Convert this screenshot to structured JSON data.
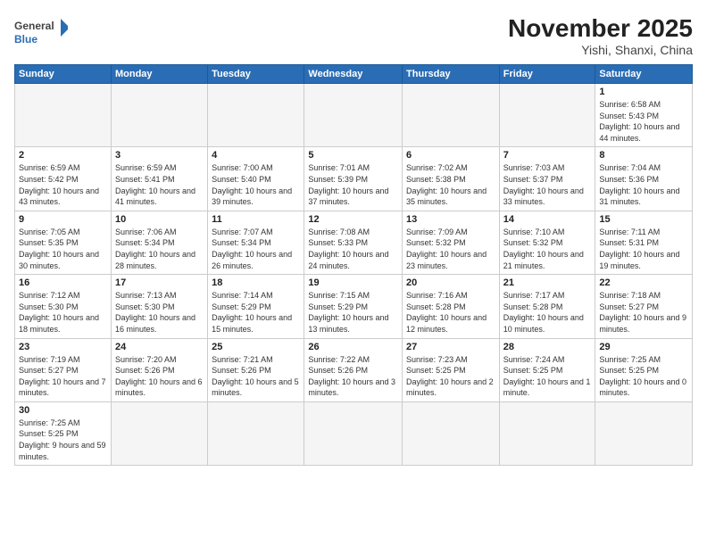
{
  "header": {
    "logo_general": "General",
    "logo_blue": "Blue",
    "month_title": "November 2025",
    "location": "Yishi, Shanxi, China"
  },
  "weekdays": [
    "Sunday",
    "Monday",
    "Tuesday",
    "Wednesday",
    "Thursday",
    "Friday",
    "Saturday"
  ],
  "weeks": [
    [
      {
        "day": "",
        "info": ""
      },
      {
        "day": "",
        "info": ""
      },
      {
        "day": "",
        "info": ""
      },
      {
        "day": "",
        "info": ""
      },
      {
        "day": "",
        "info": ""
      },
      {
        "day": "",
        "info": ""
      },
      {
        "day": "1",
        "info": "Sunrise: 6:58 AM\nSunset: 5:43 PM\nDaylight: 10 hours and 44 minutes."
      }
    ],
    [
      {
        "day": "2",
        "info": "Sunrise: 6:59 AM\nSunset: 5:42 PM\nDaylight: 10 hours and 43 minutes."
      },
      {
        "day": "3",
        "info": "Sunrise: 6:59 AM\nSunset: 5:41 PM\nDaylight: 10 hours and 41 minutes."
      },
      {
        "day": "4",
        "info": "Sunrise: 7:00 AM\nSunset: 5:40 PM\nDaylight: 10 hours and 39 minutes."
      },
      {
        "day": "5",
        "info": "Sunrise: 7:01 AM\nSunset: 5:39 PM\nDaylight: 10 hours and 37 minutes."
      },
      {
        "day": "6",
        "info": "Sunrise: 7:02 AM\nSunset: 5:38 PM\nDaylight: 10 hours and 35 minutes."
      },
      {
        "day": "7",
        "info": "Sunrise: 7:03 AM\nSunset: 5:37 PM\nDaylight: 10 hours and 33 minutes."
      },
      {
        "day": "8",
        "info": "Sunrise: 7:04 AM\nSunset: 5:36 PM\nDaylight: 10 hours and 31 minutes."
      }
    ],
    [
      {
        "day": "9",
        "info": "Sunrise: 7:05 AM\nSunset: 5:35 PM\nDaylight: 10 hours and 30 minutes."
      },
      {
        "day": "10",
        "info": "Sunrise: 7:06 AM\nSunset: 5:34 PM\nDaylight: 10 hours and 28 minutes."
      },
      {
        "day": "11",
        "info": "Sunrise: 7:07 AM\nSunset: 5:34 PM\nDaylight: 10 hours and 26 minutes."
      },
      {
        "day": "12",
        "info": "Sunrise: 7:08 AM\nSunset: 5:33 PM\nDaylight: 10 hours and 24 minutes."
      },
      {
        "day": "13",
        "info": "Sunrise: 7:09 AM\nSunset: 5:32 PM\nDaylight: 10 hours and 23 minutes."
      },
      {
        "day": "14",
        "info": "Sunrise: 7:10 AM\nSunset: 5:32 PM\nDaylight: 10 hours and 21 minutes."
      },
      {
        "day": "15",
        "info": "Sunrise: 7:11 AM\nSunset: 5:31 PM\nDaylight: 10 hours and 19 minutes."
      }
    ],
    [
      {
        "day": "16",
        "info": "Sunrise: 7:12 AM\nSunset: 5:30 PM\nDaylight: 10 hours and 18 minutes."
      },
      {
        "day": "17",
        "info": "Sunrise: 7:13 AM\nSunset: 5:30 PM\nDaylight: 10 hours and 16 minutes."
      },
      {
        "day": "18",
        "info": "Sunrise: 7:14 AM\nSunset: 5:29 PM\nDaylight: 10 hours and 15 minutes."
      },
      {
        "day": "19",
        "info": "Sunrise: 7:15 AM\nSunset: 5:29 PM\nDaylight: 10 hours and 13 minutes."
      },
      {
        "day": "20",
        "info": "Sunrise: 7:16 AM\nSunset: 5:28 PM\nDaylight: 10 hours and 12 minutes."
      },
      {
        "day": "21",
        "info": "Sunrise: 7:17 AM\nSunset: 5:28 PM\nDaylight: 10 hours and 10 minutes."
      },
      {
        "day": "22",
        "info": "Sunrise: 7:18 AM\nSunset: 5:27 PM\nDaylight: 10 hours and 9 minutes."
      }
    ],
    [
      {
        "day": "23",
        "info": "Sunrise: 7:19 AM\nSunset: 5:27 PM\nDaylight: 10 hours and 7 minutes."
      },
      {
        "day": "24",
        "info": "Sunrise: 7:20 AM\nSunset: 5:26 PM\nDaylight: 10 hours and 6 minutes."
      },
      {
        "day": "25",
        "info": "Sunrise: 7:21 AM\nSunset: 5:26 PM\nDaylight: 10 hours and 5 minutes."
      },
      {
        "day": "26",
        "info": "Sunrise: 7:22 AM\nSunset: 5:26 PM\nDaylight: 10 hours and 3 minutes."
      },
      {
        "day": "27",
        "info": "Sunrise: 7:23 AM\nSunset: 5:25 PM\nDaylight: 10 hours and 2 minutes."
      },
      {
        "day": "28",
        "info": "Sunrise: 7:24 AM\nSunset: 5:25 PM\nDaylight: 10 hours and 1 minute."
      },
      {
        "day": "29",
        "info": "Sunrise: 7:25 AM\nSunset: 5:25 PM\nDaylight: 10 hours and 0 minutes."
      }
    ],
    [
      {
        "day": "30",
        "info": "Sunrise: 7:25 AM\nSunset: 5:25 PM\nDaylight: 9 hours and 59 minutes."
      },
      {
        "day": "",
        "info": ""
      },
      {
        "day": "",
        "info": ""
      },
      {
        "day": "",
        "info": ""
      },
      {
        "day": "",
        "info": ""
      },
      {
        "day": "",
        "info": ""
      },
      {
        "day": "",
        "info": ""
      }
    ]
  ]
}
